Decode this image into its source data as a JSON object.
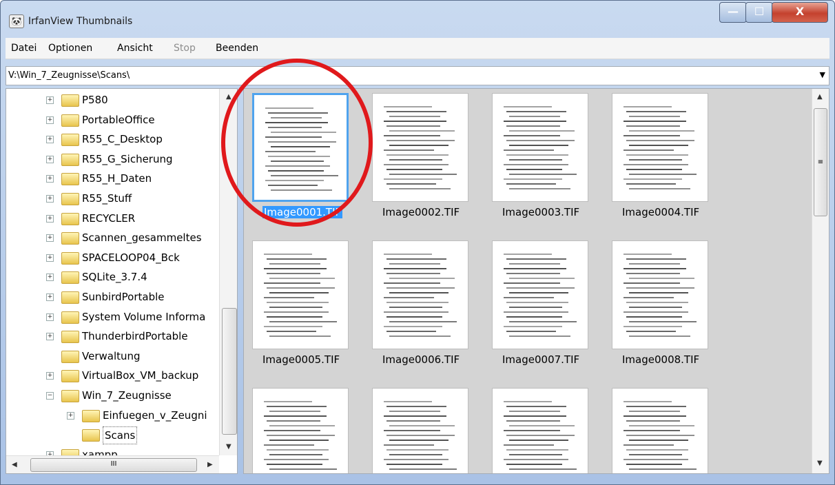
{
  "window": {
    "title": "IrfanView Thumbnails",
    "close_glyph": "X",
    "min_glyph": "—",
    "max_glyph": "☐"
  },
  "menu": [
    "Datei",
    "Optionen",
    "Ansicht",
    "Stop",
    "Beenden"
  ],
  "path": "V:\\Win_7_Zeugnisse\\Scans\\",
  "tree": [
    {
      "label": "P580"
    },
    {
      "label": "PortableOffice"
    },
    {
      "label": "R55_C_Desktop"
    },
    {
      "label": "R55_G_Sicherung"
    },
    {
      "label": "R55_H_Daten"
    },
    {
      "label": "R55_Stuff"
    },
    {
      "label": "RECYCLER"
    },
    {
      "label": "Scannen_gesammeltes"
    },
    {
      "label": "SPACELOOP04_Bck"
    },
    {
      "label": "SQLite_3.7.4"
    },
    {
      "label": "SunbirdPortable"
    },
    {
      "label": "System Volume Informa"
    },
    {
      "label": "ThunderbirdPortable"
    },
    {
      "label": "Verwaltung"
    },
    {
      "label": "VirtualBox_VM_backup"
    },
    {
      "label": "Win_7_Zeugnisse"
    },
    {
      "label": "Einfuegen_v_Zeugni"
    },
    {
      "label": "Scans"
    },
    {
      "label": "xampp"
    }
  ],
  "thumbnails": [
    {
      "name": "Image0001.TIF"
    },
    {
      "name": "Image0002.TIF"
    },
    {
      "name": "Image0003.TIF"
    },
    {
      "name": "Image0004.TIF"
    },
    {
      "name": "Image0005.TIF"
    },
    {
      "name": "Image0006.TIF"
    },
    {
      "name": "Image0007.TIF"
    },
    {
      "name": "Image0008.TIF"
    },
    {
      "name": ""
    },
    {
      "name": ""
    },
    {
      "name": ""
    },
    {
      "name": ""
    }
  ],
  "scroll": {
    "hthumb_glyph": "III",
    "vthumb_glyph": "≡"
  },
  "colors": {
    "selection": "#3399ff",
    "annotation_circle": "#e0191c"
  },
  "icons": {
    "folder": "folder-icon",
    "close": "close-icon",
    "expander": "expand-icon"
  }
}
